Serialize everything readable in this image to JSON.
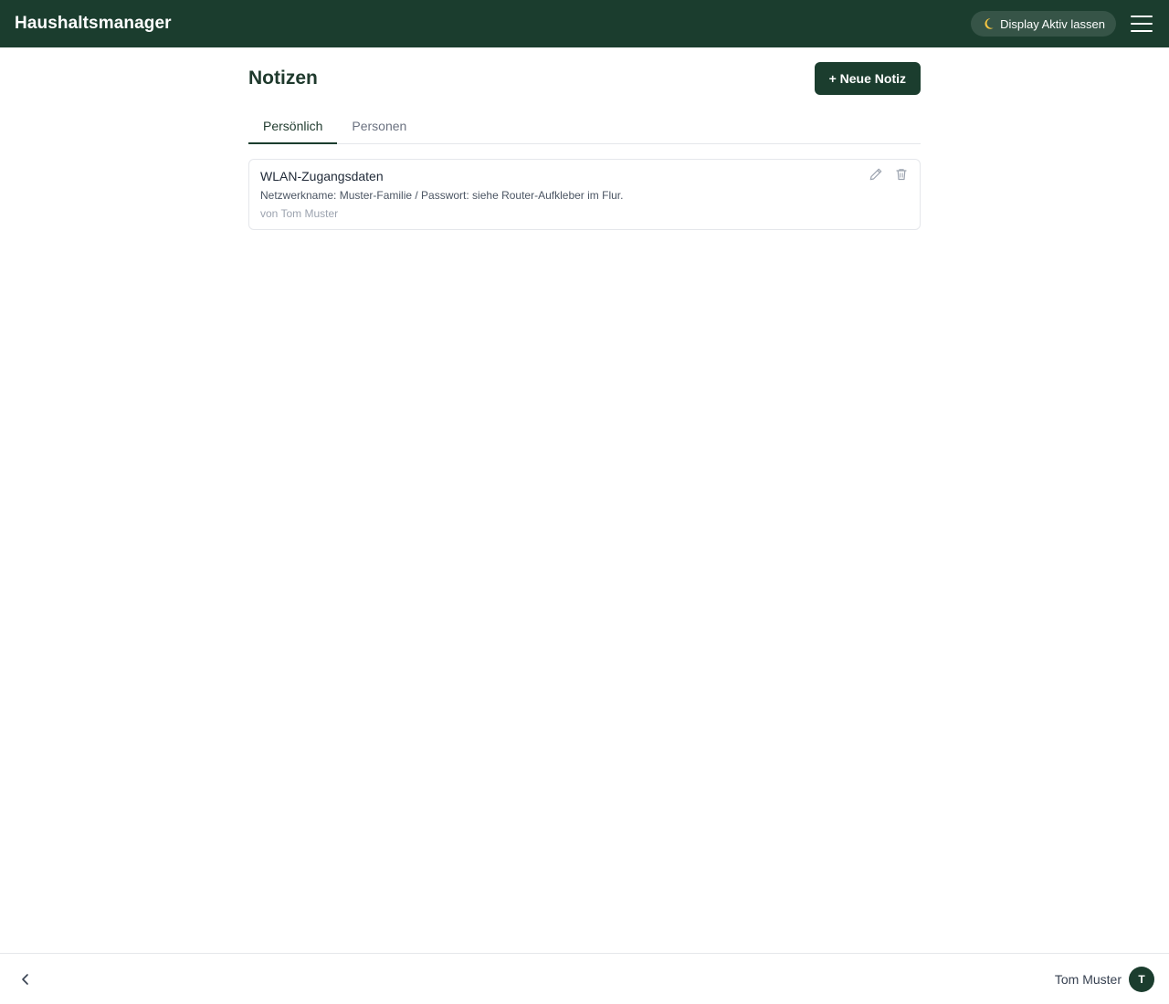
{
  "header": {
    "app_title": "Haushaltsmanager",
    "display_toggle_label": "Display Aktiv lassen",
    "display_toggle_icon": "moon-icon",
    "menu_icon": "hamburger-menu-icon",
    "background_color": "#1b3d2e"
  },
  "page": {
    "title": "Notizen",
    "new_note_label": "+ Neue Notiz"
  },
  "tabs": [
    {
      "label": "Persönlich",
      "active": true
    },
    {
      "label": "Personen",
      "active": false
    }
  ],
  "notes": [
    {
      "title": "WLAN-Zugangsdaten",
      "body": "Netzwerkname: Muster-Familie / Passwort: siehe Router-Aufkleber im Flur.",
      "author": "von Tom Muster",
      "actions": [
        "edit-icon",
        "trash-icon"
      ]
    }
  ],
  "footer": {
    "back_icon": "chevron-left-icon",
    "user_name": "Tom Muster",
    "avatar_initial": "T"
  }
}
